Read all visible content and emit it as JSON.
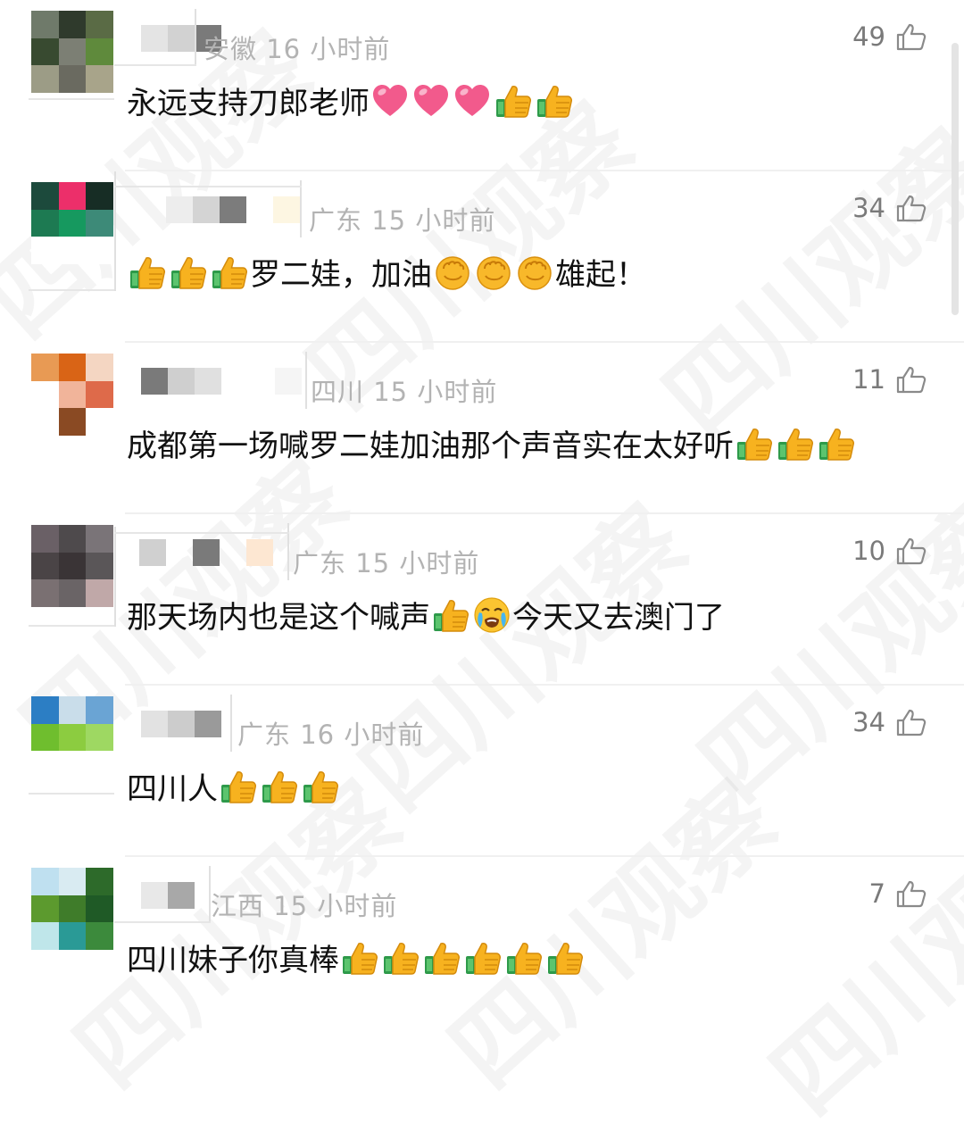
{
  "watermark": "四川观察",
  "icons": {
    "like": "thumbs-up-outline-icon",
    "thumb_emoji": "thumbs-up-emoji-icon",
    "heart_emoji": "pink-heart-emoji-icon",
    "fist_emoji": "raised-fist-emoji-icon",
    "crying_emoji": "loudly-crying-emoji-icon"
  },
  "comments": [
    {
      "location_time": "安徽 16 小时前",
      "likes": "49",
      "text": "永远支持刀郎老师",
      "avatar_colors": [
        "#6f7a6a",
        "#2f3a2c",
        "#5a6b45",
        "#384a30",
        "#7c7f74",
        "#5f8a3c",
        "#9c9c86",
        "#6a6a60",
        "#a8a48a"
      ]
    },
    {
      "location_time": "广东 15 小时前",
      "likes": "34",
      "text_a": "罗二娃，加油",
      "text_b": "雄起！",
      "avatar_colors": [
        "#1c4a3c",
        "#ec2f6a",
        "#172d25",
        "#1d7a52",
        "#16995f",
        "#3d8a78",
        "#ffffff",
        "#ffffff",
        "#ffffff"
      ]
    },
    {
      "location_time": "四川 15 小时前",
      "likes": "11",
      "text": "成都第一场喊罗二娃加油那个声音实在太好听",
      "avatar_colors": [
        "#e89a54",
        "#d96416",
        "#f4d6c2",
        "#ffffff",
        "#f1b49a",
        "#de6a4a",
        "#ffffff",
        "#8a4a23",
        "#ffffff"
      ]
    },
    {
      "location_time": "广东 15 小时前",
      "likes": "10",
      "text_a": "那天场内也是这个喊声",
      "text_b": "今天又去澳门了",
      "avatar_colors": [
        "#6a6066",
        "#4e4a4c",
        "#7a7478",
        "#4a4446",
        "#3a3436",
        "#5a5658",
        "#7a7072",
        "#6a6466",
        "#c0a8a8"
      ]
    },
    {
      "location_time": "广东 16 小时前",
      "likes": "34",
      "text": "四川人",
      "avatar_colors": [
        "#2c7ec4",
        "#c9ddea",
        "#6aa4d4",
        "#6fbe2e",
        "#8ccc40",
        "#9ed862",
        "#ffffff",
        "#ffffff",
        "#ffffff"
      ]
    },
    {
      "location_time": "江西 15 小时前",
      "likes": "7",
      "text": "四川妹子你真棒",
      "avatar_colors": [
        "#bfe0f0",
        "#d9ebf2",
        "#2d6a2a",
        "#5c9a2e",
        "#3f7c2a",
        "#1f5a26",
        "#bfe6ea",
        "#2a9a96",
        "#3c8a3c"
      ]
    }
  ]
}
